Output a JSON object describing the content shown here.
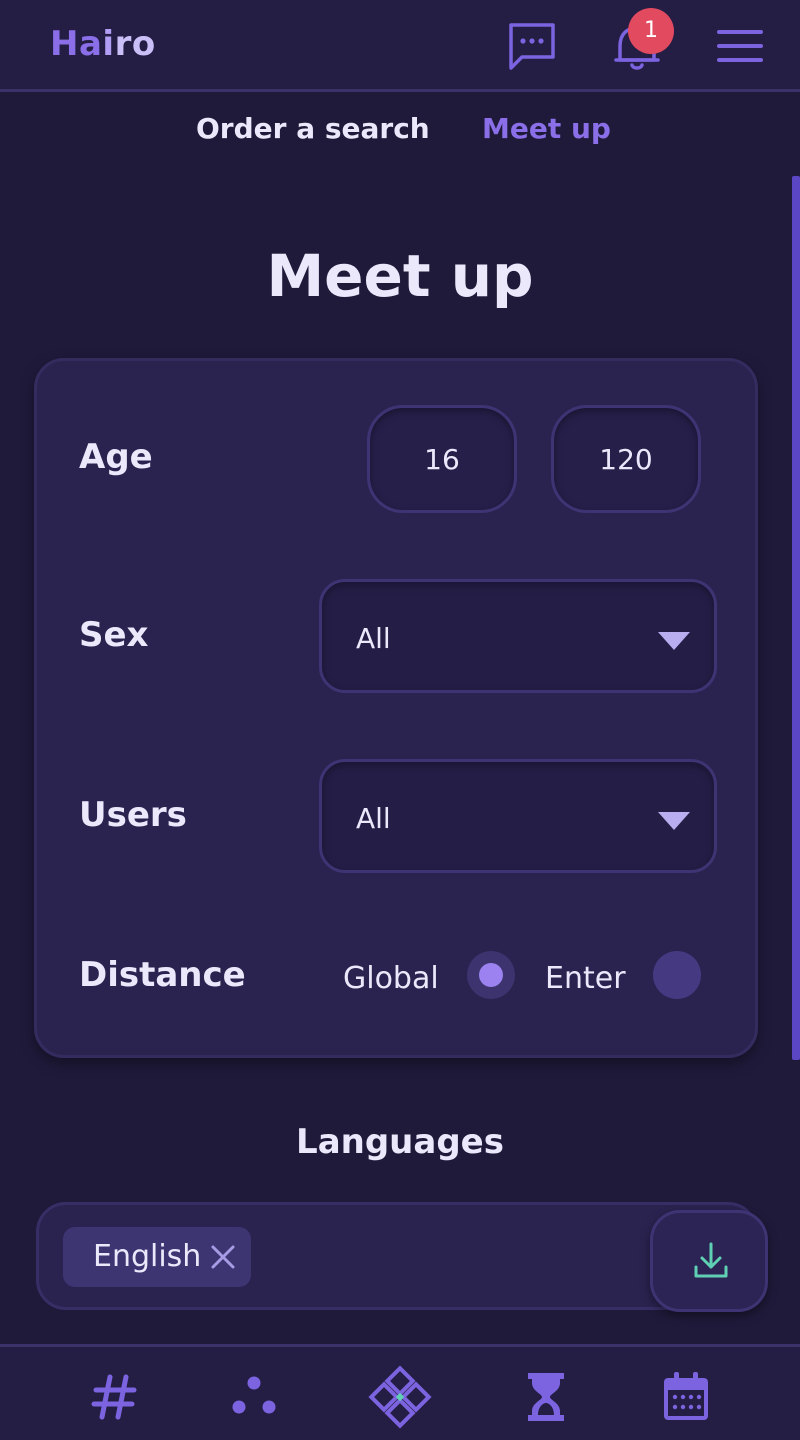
{
  "app": {
    "logo_part1": "Ha",
    "logo_part2": "i",
    "logo_part3": "ro",
    "notification_count": "1"
  },
  "tabs": [
    {
      "label": "Order a search",
      "active": false
    },
    {
      "label": "Meet up",
      "active": true
    }
  ],
  "page": {
    "title": "Meet up"
  },
  "filters": {
    "age": {
      "label": "Age",
      "min": "16",
      "max": "120"
    },
    "sex": {
      "label": "Sex",
      "value": "All"
    },
    "users": {
      "label": "Users",
      "value": "All"
    },
    "distance": {
      "label": "Distance",
      "options": [
        "Global",
        "Enter"
      ],
      "selected": "Global"
    }
  },
  "languages": {
    "title": "Languages",
    "selected": [
      "English"
    ]
  },
  "icons": {
    "header": [
      "chat-icon",
      "bell-icon",
      "menu-icon"
    ],
    "bottom_nav": [
      "hashtag-icon",
      "dots-icon",
      "diamond-home-icon",
      "hourglass-icon",
      "calendar-icon"
    ]
  },
  "colors": {
    "background": "#1f1a3a",
    "accent": "#8a6fe8",
    "badge": "#e24a60",
    "download_icon": "#5fd0b4"
  }
}
